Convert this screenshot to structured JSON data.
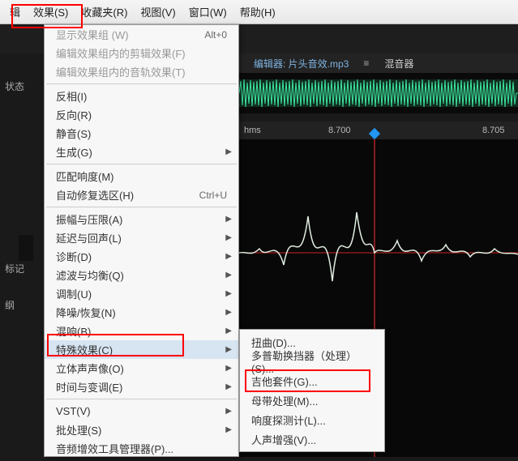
{
  "menubar": {
    "items": [
      {
        "label": "辑"
      },
      {
        "label": "效果(S)"
      },
      {
        "label": "收藏夹(R)"
      },
      {
        "label": "视图(V)"
      },
      {
        "label": "窗口(W)"
      },
      {
        "label": "帮助(H)"
      }
    ]
  },
  "left_labels": {
    "status": "状态",
    "marker": "标记",
    "level": "纲"
  },
  "editor_header": {
    "title": "编辑器: 片头音效.mp3",
    "mixer": "混音器"
  },
  "ruler": {
    "hms": "hms",
    "tick1": "8.700",
    "tick2": "8.705"
  },
  "dropdown": {
    "show_group": {
      "label": "显示效果组 (W)",
      "shortcut": "Alt+0"
    },
    "edit_clip": {
      "label": "编辑效果组内的剪辑效果(F)"
    },
    "edit_track": {
      "label": "编辑效果组内的音轨效果(T)"
    },
    "invert": {
      "label": "反相(I)"
    },
    "reverse": {
      "label": "反向(R)"
    },
    "silence": {
      "label": "静音(S)"
    },
    "generate": {
      "label": "生成(G)"
    },
    "match_loudness": {
      "label": "匹配响度(M)"
    },
    "auto_heal": {
      "label": "自动修复选区(H)",
      "shortcut": "Ctrl+U"
    },
    "amplitude": {
      "label": "振幅与压限(A)"
    },
    "delay": {
      "label": "延迟与回声(L)"
    },
    "diagnostics": {
      "label": "诊断(D)"
    },
    "filter": {
      "label": "滤波与均衡(Q)"
    },
    "modulation": {
      "label": "调制(U)"
    },
    "noise": {
      "label": "降噪/恢复(N)"
    },
    "reverb": {
      "label": "混响(B)"
    },
    "special": {
      "label": "特殊效果(C)"
    },
    "stereo": {
      "label": "立体声声像(O)"
    },
    "time_pitch": {
      "label": "时间与变调(E)"
    },
    "vst": {
      "label": "VST(V)"
    },
    "batch": {
      "label": "批处理(S)"
    },
    "plugin_mgr": {
      "label": "音频增效工具管理器(P)..."
    }
  },
  "submenu": {
    "distortion": {
      "label": "扭曲(D)..."
    },
    "doppler": {
      "label": "多普勒换挡器（处理）(S)..."
    },
    "guitar": {
      "label": "吉他套件(G)..."
    },
    "mastering": {
      "label": "母带处理(M)..."
    },
    "loudness": {
      "label": "响度探测计(L)..."
    },
    "vocal": {
      "label": "人声增强(V)..."
    }
  },
  "colors": {
    "waveform": "#3de89f",
    "waveform_line": "#d8e8d8",
    "playhead": "#ff3030"
  }
}
